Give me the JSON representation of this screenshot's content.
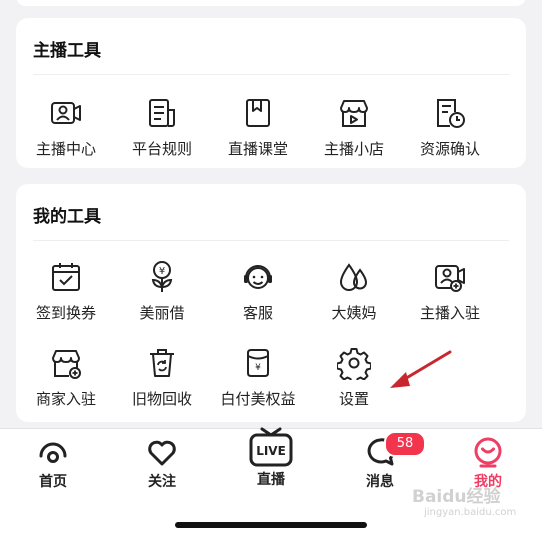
{
  "anchor_tools": {
    "title": "主播工具",
    "items": [
      {
        "label": "主播中心",
        "icon": "anchor-center-icon"
      },
      {
        "label": "平台规则",
        "icon": "platform-rules-icon"
      },
      {
        "label": "直播课堂",
        "icon": "live-classroom-icon"
      },
      {
        "label": "主播小店",
        "icon": "anchor-shop-icon"
      },
      {
        "label": "资源确认",
        "icon": "resource-confirm-icon"
      }
    ]
  },
  "my_tools": {
    "title": "我的工具",
    "items": [
      {
        "label": "签到换券",
        "icon": "checkin-calendar-icon"
      },
      {
        "label": "美丽借",
        "icon": "beauty-loan-icon"
      },
      {
        "label": "客服",
        "icon": "customer-service-icon"
      },
      {
        "label": "大姨妈",
        "icon": "period-tracker-icon"
      },
      {
        "label": "主播入驻",
        "icon": "anchor-join-icon"
      },
      {
        "label": "商家入驻",
        "icon": "merchant-join-icon"
      },
      {
        "label": "旧物回收",
        "icon": "recycle-icon"
      },
      {
        "label": "白付美权益",
        "icon": "baifumei-benefits-icon"
      },
      {
        "label": "设置",
        "icon": "settings-gear-icon"
      }
    ]
  },
  "tabbar": {
    "items": [
      {
        "label": "首页",
        "icon": "home-icon"
      },
      {
        "label": "关注",
        "icon": "heart-icon"
      },
      {
        "label": "直播",
        "icon": "live-tv-icon",
        "icon_text": "LIVE"
      },
      {
        "label": "消息",
        "icon": "message-icon",
        "badge": "58"
      },
      {
        "label": "我的",
        "icon": "profile-icon",
        "active": true
      }
    ]
  },
  "colors": {
    "accent": "#ef3e63",
    "badge": "#f2344d",
    "annotation_arrow": "#c8282d"
  },
  "watermark": {
    "brand": "Baidu经验",
    "sub": "jingyan.baidu.com"
  }
}
